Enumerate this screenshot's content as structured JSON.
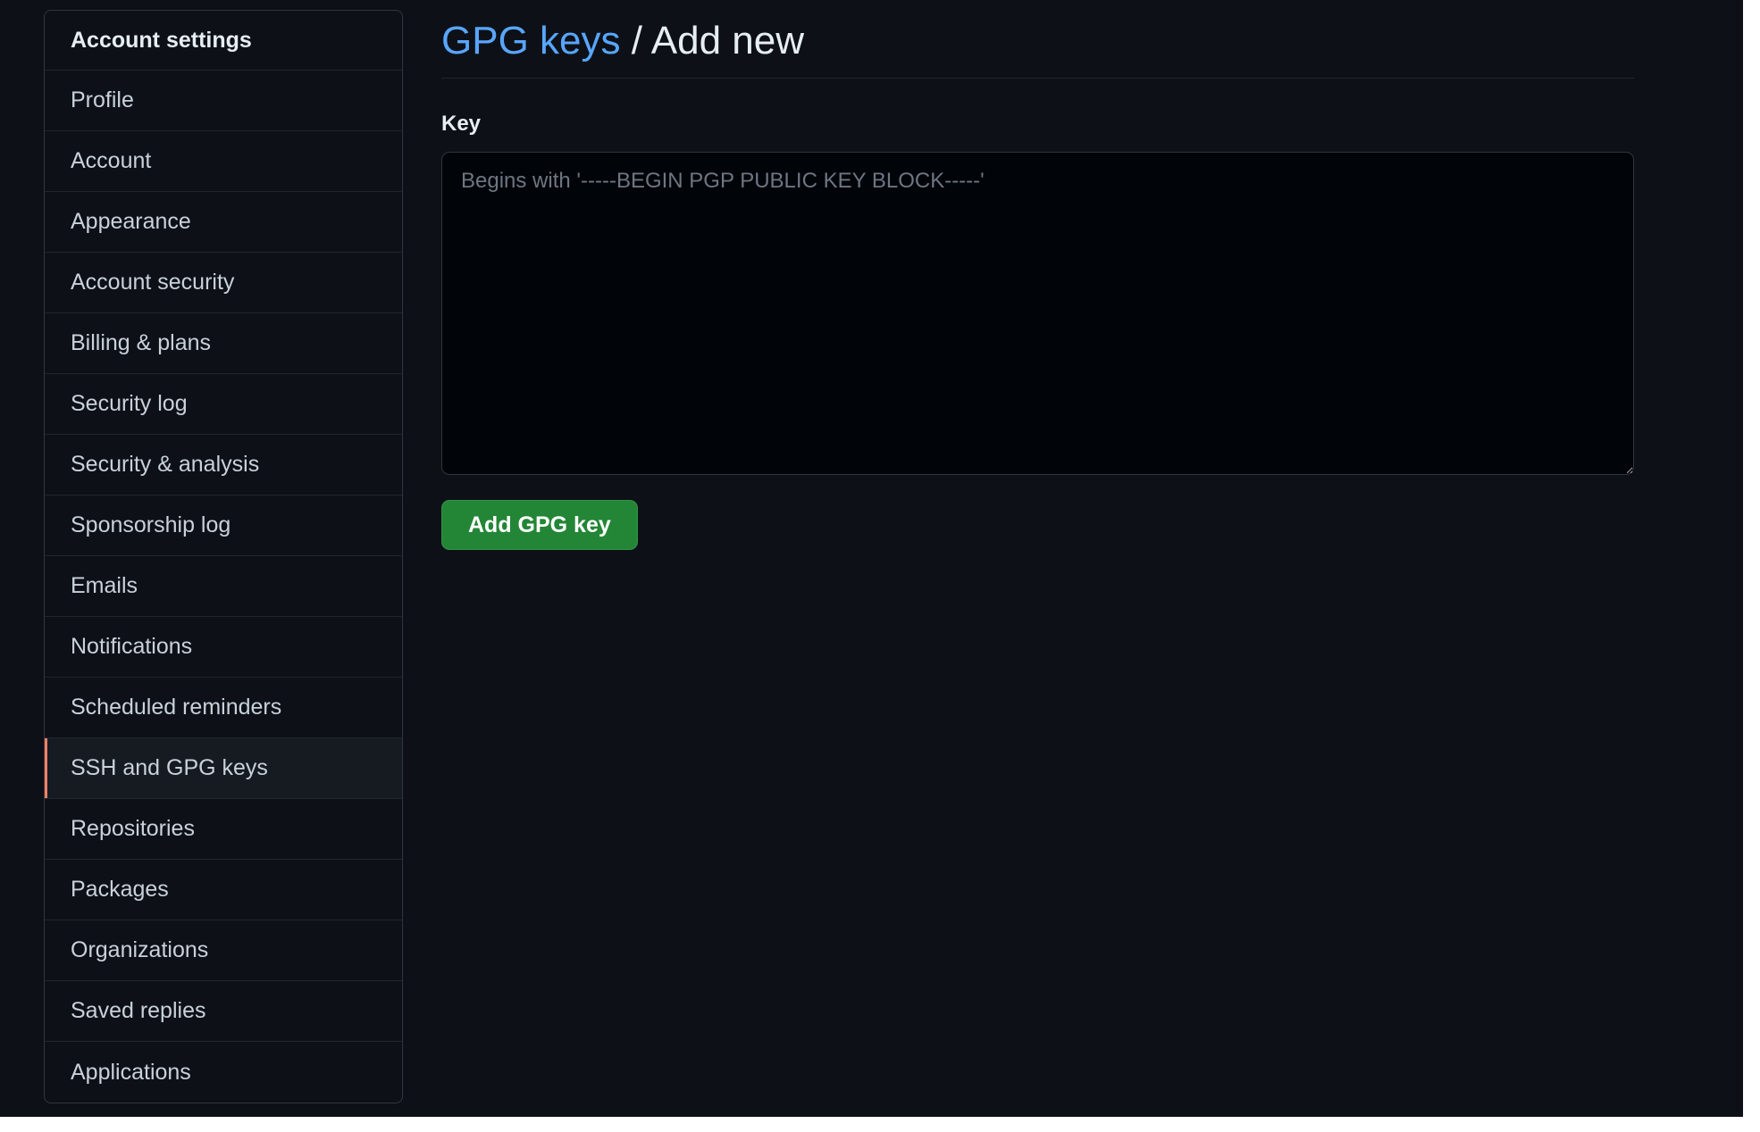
{
  "sidebar": {
    "heading": "Account settings",
    "items": [
      {
        "label": "Profile"
      },
      {
        "label": "Account"
      },
      {
        "label": "Appearance"
      },
      {
        "label": "Account security"
      },
      {
        "label": "Billing & plans"
      },
      {
        "label": "Security log"
      },
      {
        "label": "Security & analysis"
      },
      {
        "label": "Sponsorship log"
      },
      {
        "label": "Emails"
      },
      {
        "label": "Notifications"
      },
      {
        "label": "Scheduled reminders"
      },
      {
        "label": "SSH and GPG keys",
        "active": true
      },
      {
        "label": "Repositories"
      },
      {
        "label": "Packages"
      },
      {
        "label": "Organizations"
      },
      {
        "label": "Saved replies"
      },
      {
        "label": "Applications"
      }
    ]
  },
  "main": {
    "breadcrumb_link": "GPG keys",
    "breadcrumb_separator": " / ",
    "breadcrumb_current": "Add new",
    "key_label": "Key",
    "key_value": "",
    "key_placeholder": "Begins with '-----BEGIN PGP PUBLIC KEY BLOCK-----'",
    "submit_label": "Add GPG key"
  },
  "colors": {
    "background": "#0d1117",
    "link": "#58a6ff",
    "active_indicator": "#f78166",
    "primary_button": "#238636"
  }
}
